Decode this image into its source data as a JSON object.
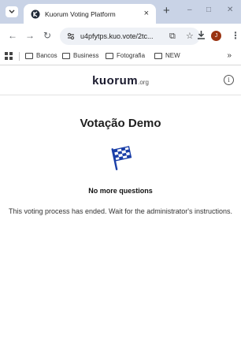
{
  "browser": {
    "tab_title": "Kuorum Voting Platform",
    "tab_close": "×",
    "new_tab": "+",
    "window_minimize": "–",
    "window_maximize": "□",
    "window_close": "✕",
    "url": "u4pfytps.kuo.vote/2tc...",
    "bookmarks": [
      "Bancos",
      "Business",
      "Fotografia",
      "NEW"
    ],
    "bookmarks_more": "»",
    "profile_initial": "J"
  },
  "header": {
    "logo_main": "kuorum",
    "logo_sub": ".org",
    "info_symbol": "i"
  },
  "main": {
    "title": "Votação Demo",
    "status_title": "No more questions",
    "status_message": "This voting process has ended. Wait for the administrator's instructions.",
    "icon": "checkered-flag-icon"
  },
  "colors": {
    "accent": "#1a3fa8",
    "tabstrip": "#c9d3e6"
  }
}
